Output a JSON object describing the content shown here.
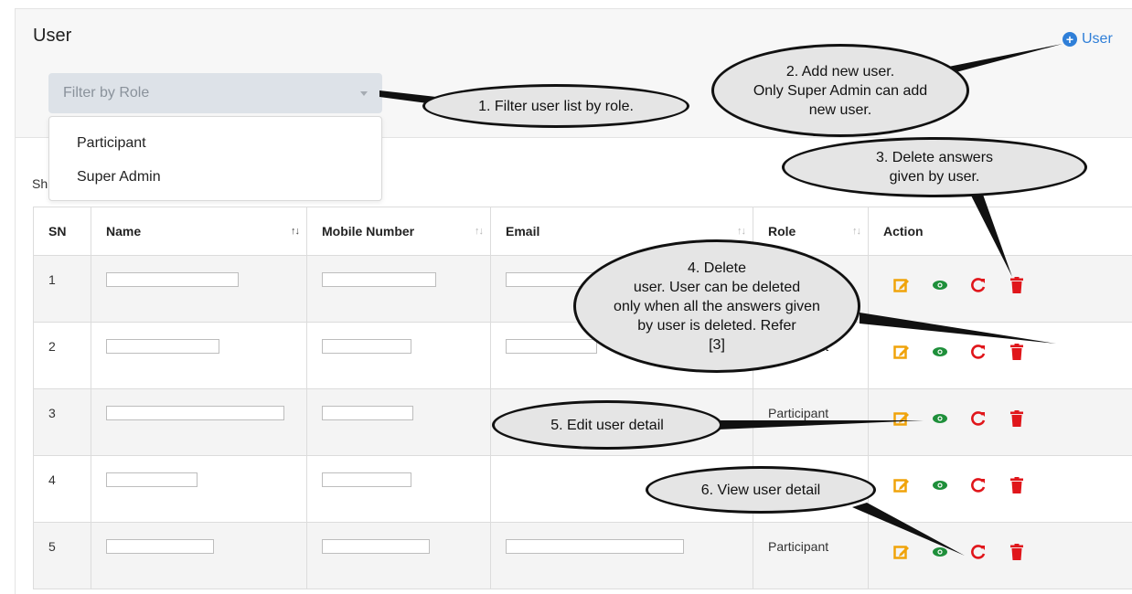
{
  "header": {
    "title": "User",
    "add_user_label": "User"
  },
  "filter": {
    "placeholder": "Filter by Role",
    "options": [
      "Participant",
      "Super Admin"
    ]
  },
  "show_label": "Sh",
  "table": {
    "columns": [
      "SN",
      "Name",
      "Mobile Number",
      "Email",
      "Role",
      "Action"
    ],
    "rows": [
      {
        "sn": "1",
        "role": ""
      },
      {
        "sn": "2",
        "role": "Participant"
      },
      {
        "sn": "3",
        "role": "Participant"
      },
      {
        "sn": "4",
        "role": ""
      },
      {
        "sn": "5",
        "role": "Participant"
      }
    ]
  },
  "icons": {
    "edit": "edit-icon",
    "view": "eye-icon",
    "reset": "reset-answers-icon",
    "delete": "trash-icon",
    "add": "plus-circle-icon"
  },
  "colors": {
    "accent": "#2f7fd8",
    "edit": "#f0a30a",
    "view": "#1e8f3a",
    "danger": "#e0161b"
  },
  "callouts": {
    "c1": "1. Filter user list by role.",
    "c2_line1": "2. Add new user.",
    "c2_line2": "Only Super Admin can add",
    "c2_line3": "new user.",
    "c3_line1": "3. Delete answers",
    "c3_line2": "given by user.",
    "c4_line1": "4. Delete",
    "c4_line2": "user. User can be deleted",
    "c4_line3": "only when all the answers given",
    "c4_line4": "by user is deleted. Refer",
    "c4_line5": "[3]",
    "c5": "5. Edit user detail",
    "c6": "6. View user detail"
  }
}
